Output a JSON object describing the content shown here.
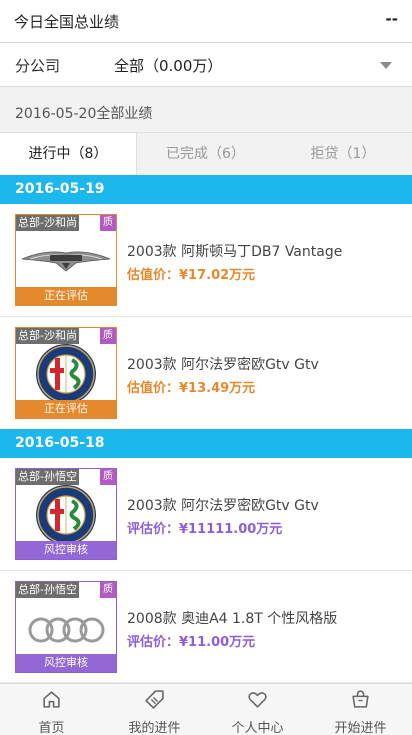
{
  "header": {
    "title": "今日全国总业绩",
    "menu": "--"
  },
  "filter": {
    "label": "分公司",
    "value": "全部（0.00万）"
  },
  "summary": {
    "text": "2016-05-20全部业绩"
  },
  "tabs": [
    {
      "label": "进行中（8）"
    },
    {
      "label": "已完成（6）"
    },
    {
      "label": "拒贷（1）"
    }
  ],
  "sections": [
    {
      "date": "2016-05-19"
    },
    {
      "date": "2016-05-18"
    }
  ],
  "items": [
    {
      "tag": "总部-沙和尚",
      "badge": "质",
      "status": "正在评估",
      "name": "2003款 阿斯顿马丁DB7 Vantage",
      "price": "估值价：¥17.02万元",
      "logo": "aston-martin-logo"
    },
    {
      "tag": "总部-沙和尚",
      "badge": "质",
      "status": "正在评估",
      "name": "2003款 阿尔法罗密欧Gtv Gtv",
      "price": "估值价：¥13.49万元",
      "logo": "alfa-romeo-logo"
    },
    {
      "tag": "总部-孙悟空",
      "badge": "质",
      "status": "风控审核",
      "name": "2003款 阿尔法罗密欧Gtv Gtv",
      "price": "评估价：¥11111.00万元",
      "logo": "alfa-romeo-logo"
    },
    {
      "tag": "总部-孙悟空",
      "badge": "质",
      "status": "风控审核",
      "name": "2008款 奥迪A4 1.8T 个性风格版",
      "price": "评估价：¥11.00万元",
      "logo": "audi-logo"
    }
  ],
  "nav": [
    {
      "label": "首页",
      "icon": "home-icon"
    },
    {
      "label": "我的进件",
      "icon": "tag-icon"
    },
    {
      "label": "个人中心",
      "icon": "heart-icon"
    },
    {
      "label": "开始进件",
      "icon": "basket-icon"
    }
  ],
  "colors": {
    "accent": "#1cb7ec",
    "orange": "#e5892d",
    "purple": "#8a5fd8",
    "badge": "#b35bc3"
  }
}
